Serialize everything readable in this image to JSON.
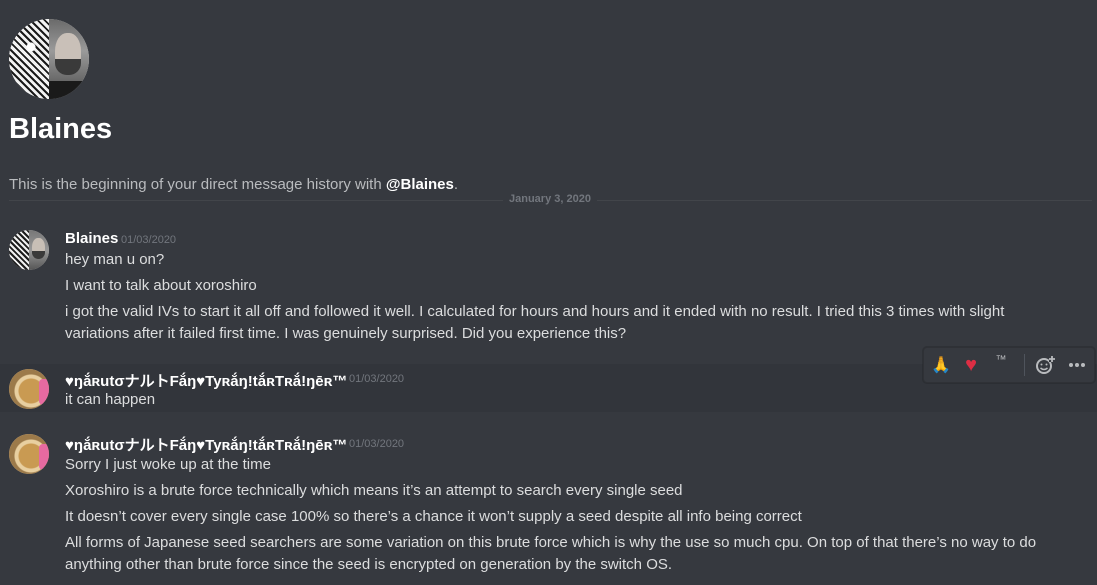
{
  "header": {
    "title": "Blaines",
    "intro_prefix": "This is the beginning of your direct message history with ",
    "intro_handle": "@Blaines",
    "intro_suffix": "."
  },
  "divider": {
    "date": "January 3, 2020"
  },
  "messages": [
    {
      "author": "Blaines",
      "timestamp": "01/03/2020",
      "lines": [
        "hey man u on?",
        "I want to talk about xoroshiro",
        "i got the valid IVs to start it all off and followed it well. I calculated for hours and hours and it ended with no result. I tried this 3 times with slight variations after it failed first time. I was genuinely surprised. Did you experience this?"
      ]
    },
    {
      "author": "♥ŋắʀutσナルトFắŋ♥Tyʀắŋ!tắʀTʀắ!ŋēʀ™",
      "timestamp": "01/03/2020",
      "lines": [
        "it can happen"
      ]
    },
    {
      "author": "♥ŋắʀutσナルトFắŋ♥Tyʀắŋ!tắʀTʀắ!ŋēʀ™",
      "timestamp": "01/03/2020",
      "lines": [
        "Sorry I just woke up at the time",
        "Xoroshiro is a brute force technically which means it’s an attempt to search every single seed",
        "It doesn’t cover every single case 100% so there’s a chance it won’t supply a seed despite all info being correct",
        "All forms of Japanese seed searchers are some variation on this brute force which is why the use so much cpu. On top of that there’s no way to do anything other than brute force since the seed is encrypted on generation by the switch OS."
      ]
    }
  ],
  "toolbar": {
    "reaction_1": "🙏",
    "reaction_2": "♥",
    "reaction_3": "™",
    "add_reaction_icon": "add-reaction-icon",
    "more_icon": "more-options-icon",
    "heart_color": "#dd2e44"
  }
}
